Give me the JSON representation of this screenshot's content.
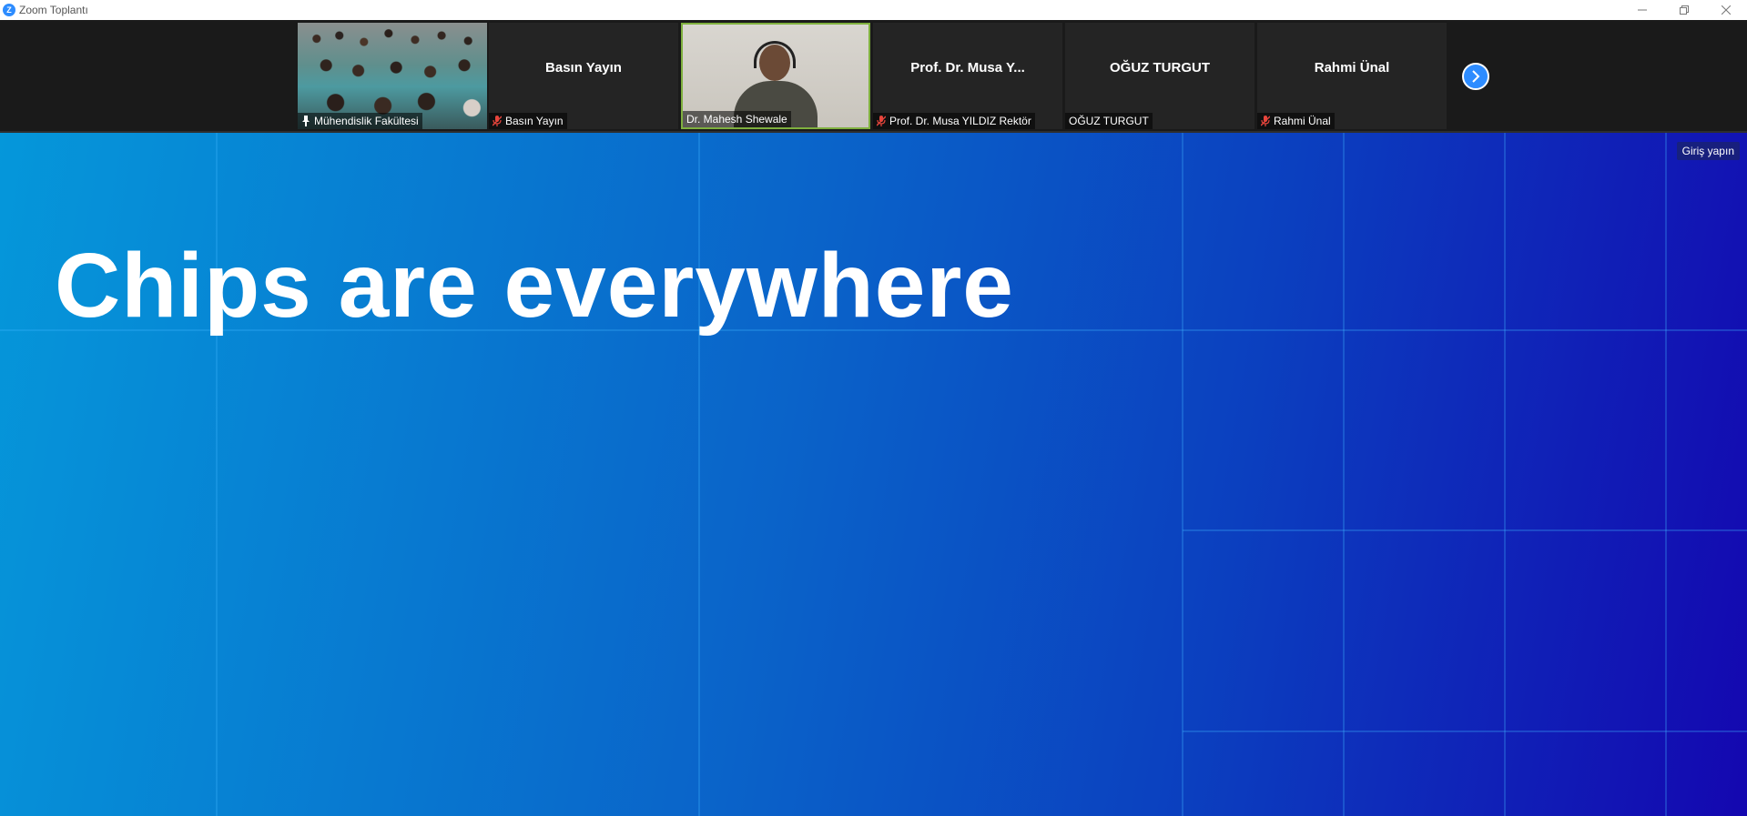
{
  "window": {
    "title": "Zoom Toplantı",
    "logo_letter": "Z",
    "controls": [
      "minimize-icon",
      "restore-icon",
      "close-icon"
    ]
  },
  "participants": [
    {
      "id": "muhendislik",
      "label": "Mühendislik Fakültesi",
      "center_name": "",
      "has_video": true,
      "video_kind": "audience",
      "label_icon": "pin-icon",
      "muted": false,
      "active_speaker": false
    },
    {
      "id": "basin",
      "label": "Basın Yayın",
      "center_name": "Basın Yayın",
      "has_video": false,
      "label_icon": "mic-muted-icon",
      "muted": true,
      "active_speaker": false
    },
    {
      "id": "mahesh",
      "label": "Dr. Mahesh Shewale",
      "center_name": "",
      "has_video": true,
      "video_kind": "speaker",
      "label_icon": "",
      "muted": false,
      "active_speaker": true
    },
    {
      "id": "musa",
      "label": "Prof. Dr. Musa YILDIZ Rektör",
      "center_name": "Prof. Dr. Musa Y...",
      "has_video": false,
      "label_icon": "mic-muted-icon",
      "muted": true,
      "active_speaker": false
    },
    {
      "id": "oguz",
      "label": "OĞUZ TURGUT",
      "center_name": "OĞUZ TURGUT",
      "has_video": false,
      "label_icon": "",
      "muted": false,
      "active_speaker": false
    },
    {
      "id": "rahmi",
      "label": "Rahmi Ünal",
      "center_name": "Rahmi Ünal",
      "has_video": false,
      "label_icon": "mic-muted-icon",
      "muted": true,
      "active_speaker": false
    }
  ],
  "strip": {
    "next_icon": "chevron-right-icon",
    "accent_color": "#2d8cff",
    "active_border_color": "#7fb03e"
  },
  "slide": {
    "title": "Chips are everywhere",
    "signin_label": "Giriş yapın",
    "gradient_colors": [
      "#0597da",
      "#0a63c9",
      "#0b3fbf",
      "#1407b0"
    ],
    "grid_line_color": "#3fb6ff"
  }
}
